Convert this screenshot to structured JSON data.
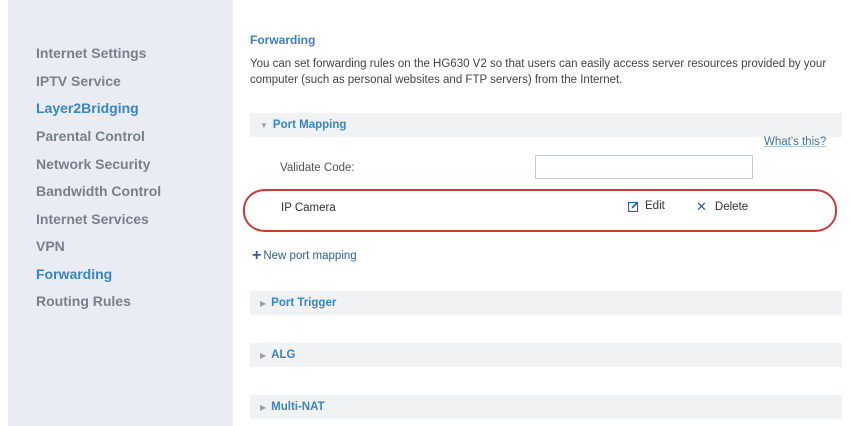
{
  "sidebar": {
    "items": [
      {
        "label": "Internet Settings",
        "active": false
      },
      {
        "label": "IPTV Service",
        "active": false
      },
      {
        "label": "Layer2Bridging",
        "active": true
      },
      {
        "label": "Parental Control",
        "active": false
      },
      {
        "label": "Network Security",
        "active": false
      },
      {
        "label": "Bandwidth Control",
        "active": false
      },
      {
        "label": "Internet Services",
        "active": false
      },
      {
        "label": "VPN",
        "active": false
      },
      {
        "label": "Forwarding",
        "active": true
      },
      {
        "label": "Routing Rules",
        "active": false
      }
    ]
  },
  "main": {
    "title": "Forwarding",
    "intro": "You can set forwarding rules on the HG630 V2 so that users can easily access server resources provided by your computer (such as personal websites and FTP servers) from the Internet.",
    "port_mapping": {
      "label": "Port Mapping",
      "expanded": true,
      "whats_this": "What's this?",
      "validate_label": "Validate Code:",
      "validate_value": "",
      "entries": [
        {
          "name": "IP Camera",
          "edit_label": "Edit",
          "delete_label": "Delete",
          "edit_icon": "edit-icon",
          "delete_icon": "close-icon"
        }
      ],
      "new_label": "New port mapping"
    },
    "sections": [
      {
        "label": "Port Trigger",
        "expanded": false
      },
      {
        "label": "ALG",
        "expanded": false
      },
      {
        "label": "Multi-NAT",
        "expanded": false
      }
    ]
  },
  "colors": {
    "accent": "#3a84c4",
    "sidebar_bg": "#e9edf3",
    "highlight_oval": "#cc3a3a"
  }
}
